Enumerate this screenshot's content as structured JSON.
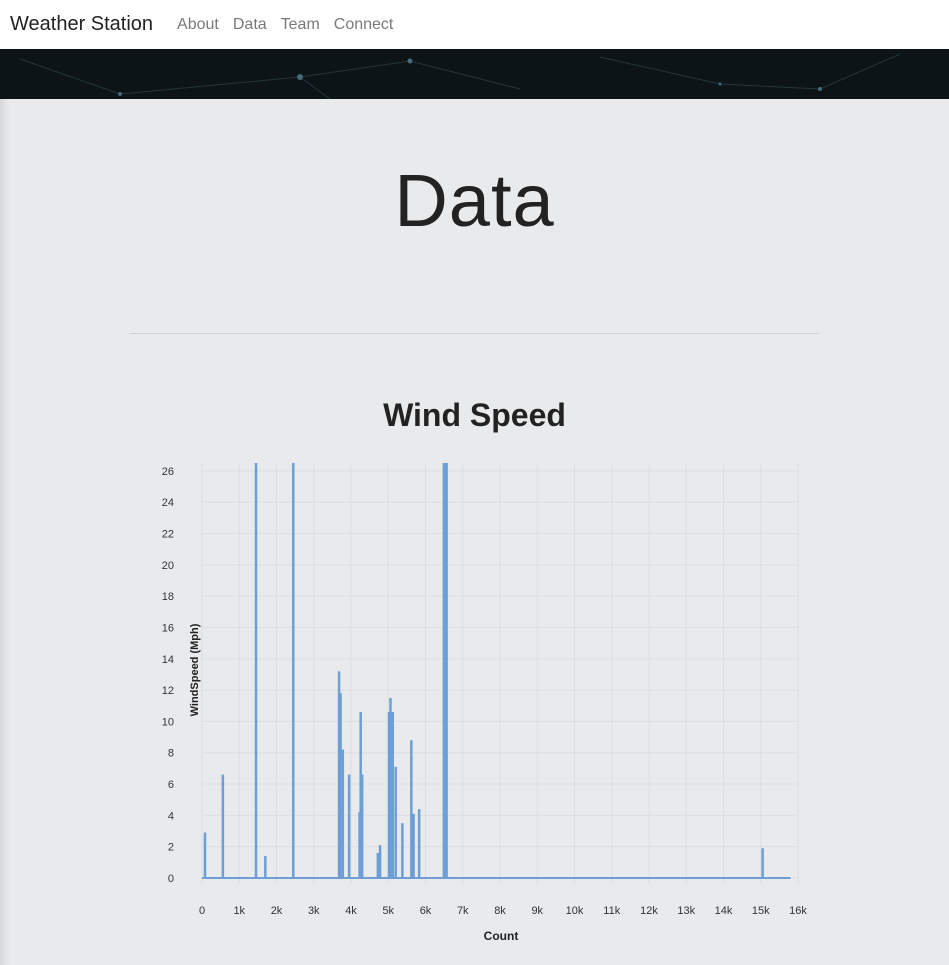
{
  "navbar": {
    "brand": "Weather Station",
    "links": [
      "About",
      "Data",
      "Team",
      "Connect"
    ]
  },
  "page": {
    "title": "Data"
  },
  "colors": {
    "series": "#6d9fd6",
    "grid": "#dcdfe2",
    "background": "#e8eaec"
  },
  "chart_data": {
    "type": "bar",
    "title": "Wind Speed",
    "xlabel": "Count",
    "ylabel": "WindSpeed (Mph)",
    "xlim": [
      0,
      16000
    ],
    "ylim": [
      0,
      26.5
    ],
    "x_ticks": [
      0,
      1000,
      2000,
      3000,
      4000,
      5000,
      6000,
      7000,
      8000,
      9000,
      10000,
      11000,
      12000,
      13000,
      14000,
      15000,
      16000
    ],
    "x_tick_labels": [
      "0",
      "1k",
      "2k",
      "3k",
      "4k",
      "5k",
      "6k",
      "7k",
      "8k",
      "9k",
      "10k",
      "11k",
      "12k",
      "13k",
      "14k",
      "15k",
      "16k"
    ],
    "y_ticks": [
      0,
      2,
      4,
      6,
      8,
      10,
      12,
      14,
      16,
      18,
      20,
      22,
      24,
      26
    ],
    "grid": true,
    "legend": "none",
    "x": [
      80,
      560,
      1450,
      1700,
      2450,
      3680,
      3720,
      3780,
      3950,
      4230,
      4260,
      4300,
      4720,
      4780,
      5020,
      5060,
      5120,
      5200,
      5380,
      5620,
      5680,
      5830,
      6500,
      6560,
      15050
    ],
    "values": [
      2.9,
      6.6,
      26.5,
      1.4,
      26.5,
      13.2,
      11.8,
      8.2,
      6.6,
      4.2,
      10.6,
      6.6,
      1.6,
      2.1,
      10.6,
      11.5,
      10.6,
      7.1,
      3.5,
      8.8,
      4.1,
      4.4,
      26.5,
      26.5,
      1.9
    ],
    "baseline_end": 15800
  }
}
